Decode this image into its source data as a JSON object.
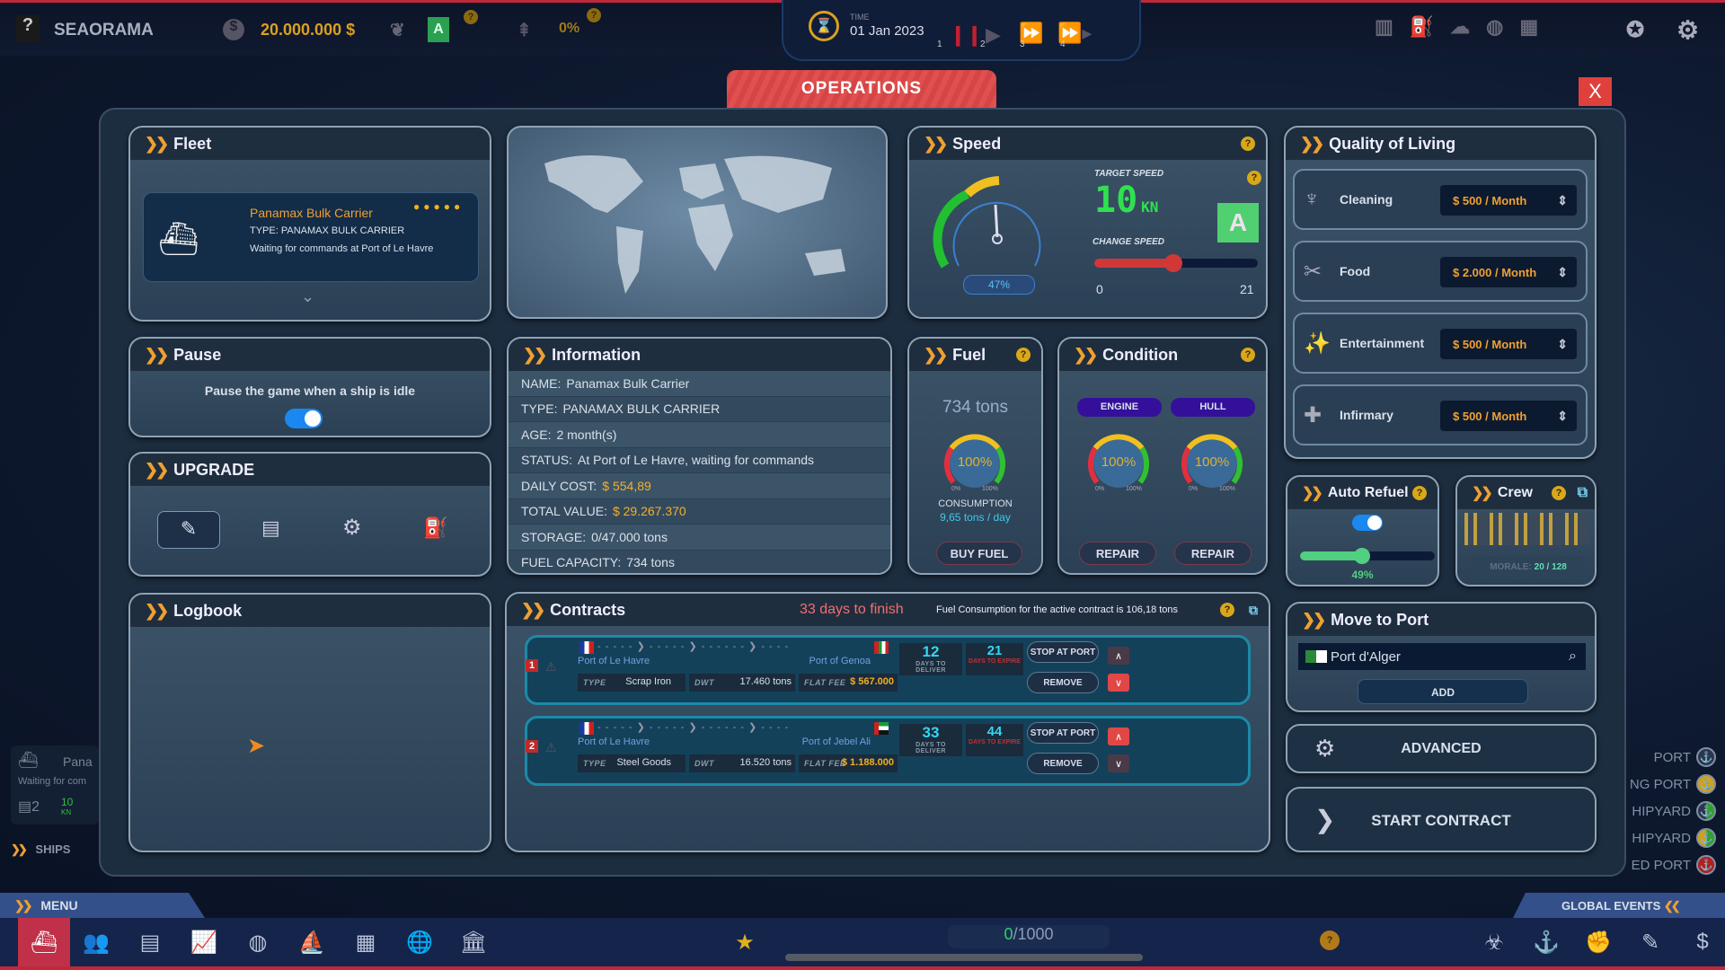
{
  "topbar": {
    "help": "?",
    "company": "SEAORAMA",
    "money": "20.000.000 $",
    "eco_grade": "A",
    "share": "0%",
    "time_label": "TIME",
    "date": "01 Jan 2023",
    "speeds": [
      "1",
      "2",
      "3",
      "4"
    ]
  },
  "dialog": {
    "title": "OPERATIONS",
    "close": "X"
  },
  "fleet": {
    "title": "Fleet",
    "ship_name": "Panamax Bulk Carrier",
    "ship_type": "TYPE: PANAMAX BULK CARRIER",
    "ship_status": "Waiting for commands at Port of Le Havre",
    "stars": 5
  },
  "pause": {
    "title": "Pause",
    "text": "Pause the game when a ship is idle",
    "enabled": true
  },
  "upgrade": {
    "title": "UPGRADE"
  },
  "logbook": {
    "title": "Logbook"
  },
  "info": {
    "title": "Information",
    "rows": [
      {
        "k": "NAME:",
        "v": "Panamax Bulk Carrier"
      },
      {
        "k": "TYPE:",
        "v": "PANAMAX BULK CARRIER"
      },
      {
        "k": "AGE:",
        "v": "2 month(s)"
      },
      {
        "k": "STATUS:",
        "v": "At Port of Le Havre, waiting for commands"
      },
      {
        "k": "DAILY COST:",
        "v": "$ 554,89",
        "gold": true
      },
      {
        "k": "TOTAL VALUE:",
        "v": "$ 29.267.370",
        "gold": true
      },
      {
        "k": "STORAGE:",
        "v": "0/47.000 tons"
      },
      {
        "k": "FUEL CAPACITY:",
        "v": "734 tons"
      }
    ]
  },
  "speed": {
    "title": "Speed",
    "gauge_ticks": [
      "0",
      "10",
      "20",
      "30",
      "40",
      "50",
      "60",
      "70",
      "80",
      "90",
      "100"
    ],
    "gauge_pct": "47%",
    "target_label": "TARGET SPEED",
    "target_value": "10",
    "unit": "KN",
    "change_label": "CHANGE SPEED",
    "min": "0",
    "max": "21",
    "slider_value": 10,
    "grade": "A"
  },
  "fuel": {
    "title": "Fuel",
    "amount": "734 tons",
    "pct": "100%",
    "g_min": "0%",
    "g_max": "100%",
    "consumption_label": "CONSUMPTION",
    "consumption": "9,65 tons / day",
    "buy": "BUY FUEL"
  },
  "condition": {
    "title": "Condition",
    "engine": "ENGINE",
    "hull": "HULL",
    "engine_pct": "100%",
    "hull_pct": "100%",
    "g_min": "0%",
    "g_max": "100%",
    "repair": "REPAIR"
  },
  "qol": {
    "title": "Quality of Living",
    "items": [
      {
        "label": "Cleaning",
        "value": "$ 500 / Month"
      },
      {
        "label": "Food",
        "value": "$ 2.000 / Month"
      },
      {
        "label": "Entertainment",
        "value": "$ 500 / Month"
      },
      {
        "label": "Infirmary",
        "value": "$ 500 / Month"
      }
    ]
  },
  "autorefuel": {
    "title": "Auto Refuel",
    "enabled": true,
    "value": "49%"
  },
  "crew": {
    "title": "Crew",
    "morale_label": "MORALE:",
    "morale": "20 / 128"
  },
  "contracts": {
    "title": "Contracts",
    "days_to_finish": "33 days to finish",
    "fuel_note": "Fuel Consumption for the active contract is 106,18 tons",
    "days_deliver_label": "DAYS TO DELIVER",
    "days_expire_label": "DAYS TO EXPIRE",
    "type_label": "TYPE",
    "dwt_label": "DWT",
    "fee_label": "FLAT FEE",
    "stop": "STOP AT PORT",
    "remove": "REMOVE",
    "items": [
      {
        "num": "1",
        "from": "Port of Le Havre",
        "to": "Port of Genoa",
        "deliver": "12",
        "expire": "21",
        "type": "Scrap Iron",
        "dwt": "17.460 tons",
        "fee": "$ 567.000"
      },
      {
        "num": "2",
        "from": "Port of Le Havre",
        "to": "Port of Jebel Ali",
        "deliver": "33",
        "expire": "44",
        "type": "Steel Goods",
        "dwt": "16.520 tons",
        "fee": "$ 1.188.000"
      }
    ]
  },
  "move": {
    "title": "Move to Port",
    "port": "Port d'Alger",
    "add": "ADD"
  },
  "advanced": "ADVANCED",
  "start": "START CONTRACT",
  "ships_list": {
    "name": "Pana",
    "status": "Waiting for com",
    "contracts": "2",
    "speed": "10",
    "unit": "KN",
    "label": "SHIPS"
  },
  "legend": [
    "PORT",
    "NG PORT",
    "HIPYARD",
    "HIPYARD",
    "ED PORT"
  ],
  "bottom": {
    "menu": "MENU",
    "global_events": "GLOBAL EVENTS",
    "progress": "0",
    "progress_max": "/1000"
  },
  "colors": {
    "accent": "#f0a030",
    "danger": "#e0403c",
    "teal": "#1c8aa8"
  }
}
